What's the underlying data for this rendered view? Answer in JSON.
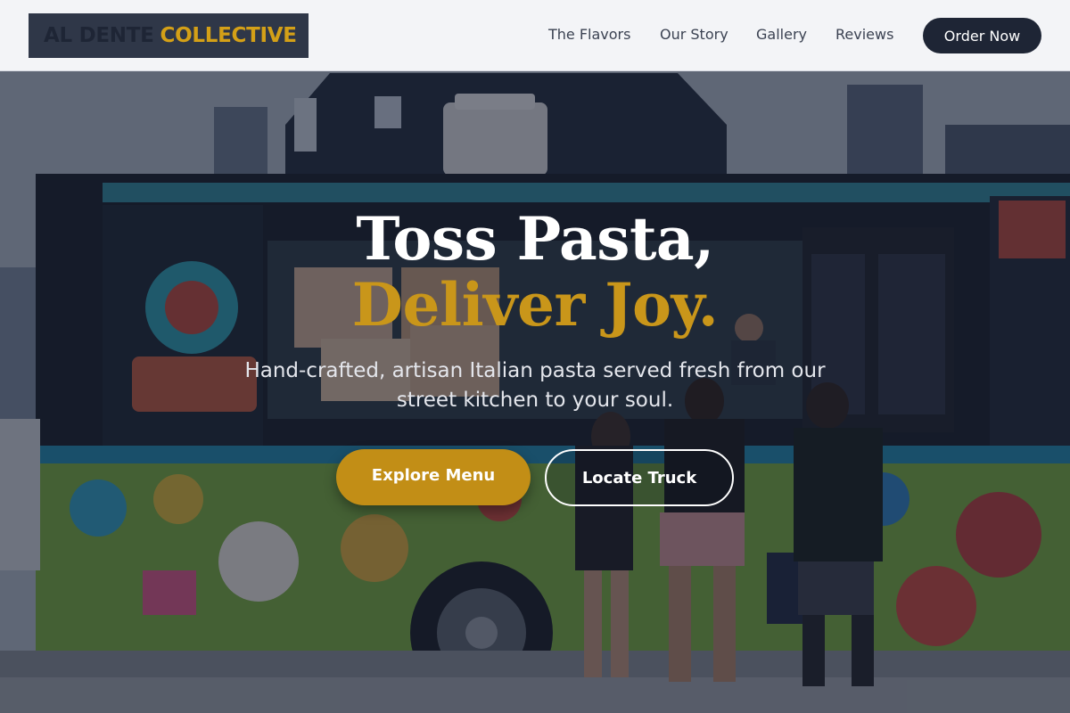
{
  "brand": {
    "name_part1": "AL DENTE",
    "name_part2": "COLLECTIVE",
    "accent_color": "#d4a017",
    "dark_color": "#1e2535"
  },
  "nav": {
    "links": [
      {
        "label": "The Flavors"
      },
      {
        "label": "Our Story"
      },
      {
        "label": "Gallery"
      },
      {
        "label": "Reviews"
      }
    ],
    "cta_label": "Order Now"
  },
  "hero": {
    "headline_line1": "Toss Pasta,",
    "headline_line2": "Deliver Joy.",
    "subtitle": "Hand-crafted, artisan Italian pasta served fresh from our street kitchen to your soul.",
    "primary_button": "Explore Menu",
    "secondary_button": "Locate Truck",
    "background_image": "food-truck-photo"
  }
}
